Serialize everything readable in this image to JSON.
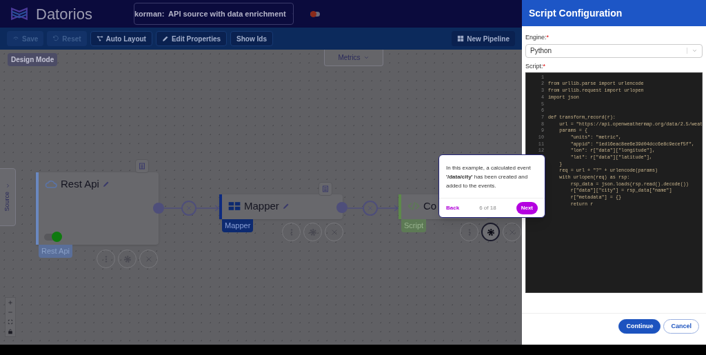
{
  "header": {
    "logo_text": "Datorios",
    "pipeline_selector": "korman:  API source with data enrichment",
    "toggle_on": false
  },
  "toolbar": {
    "buttons": [
      {
        "kind": "save",
        "label": "Save",
        "disabled": true
      },
      {
        "kind": "reset",
        "label": "Reset",
        "disabled": true
      },
      {
        "kind": "layout",
        "label": "Auto Layout",
        "disabled": false
      },
      {
        "kind": "edit",
        "label": "Edit Properties",
        "disabled": false
      },
      {
        "kind": "plain",
        "label": "Show Ids",
        "disabled": false
      }
    ],
    "new_pipeline": "New Pipeline"
  },
  "canvas": {
    "mode_badge": "Design Mode",
    "metrics_dropdown": "Metrics",
    "side_tab": "Source",
    "nodes": [
      {
        "kind": "api",
        "title": "Rest Api",
        "tag": "Rest Api",
        "enabled": true,
        "settings_selected": false
      },
      {
        "kind": "mapper",
        "title": "Mapper",
        "tag": "Mapper",
        "settings_selected": false
      },
      {
        "kind": "code",
        "title": "Co",
        "tag": "Script",
        "settings_selected": true
      }
    ]
  },
  "tour_popup": {
    "text": "In this example, a calculated event **'/data/city'** has been created and added to the events.",
    "back": "Back",
    "progress": "6 of 18",
    "next": "Next"
  },
  "panel": {
    "title": "Script Configuration",
    "engine_label": "Engine:",
    "engine_required": "*",
    "engine_value": "Python",
    "script_label": "Script:",
    "script_required": "*",
    "code_lines": [
      {
        "number": "1"
      },
      {
        "number": "2",
        "code": "from urllib.parse import urlencode"
      },
      {
        "number": "3",
        "code": "from urllib.request import urlopen"
      },
      {
        "number": "4",
        "code": "import json"
      },
      {
        "number": "5"
      },
      {
        "number": "6"
      },
      {
        "number": "7",
        "code": "def transform_record(r):"
      },
      {
        "number": "8",
        "code": "    url = \"https://api.openweathermap.org/data/2.5/weat"
      },
      {
        "number": "9",
        "code": "    params = {"
      },
      {
        "number": "10",
        "code": "        \"units\": \"metric\","
      },
      {
        "number": "11",
        "code": "        \"appid\": \"1ed16eac8ee6e39d04dcc6e8c9ecef5f\","
      },
      {
        "number": "12",
        "code": "        \"lon\": r[\"data\"][\"longitude\"],"
      },
      {
        "code": "        \"lat\": r[\"data\"][\"latitude\"],"
      },
      {
        "code": "    }"
      },
      {
        "code": "    req = url + \"?\" + urlencode(params)"
      },
      {
        "code": "    with urlopen(req) as rsp:"
      },
      {
        "code": "        rsp_data = json.loads(rsp.read().decode())"
      },
      {
        "code": "        r[\"data\"][\"city\"] = rsp_data[\"name\"]"
      },
      {
        "code": "        r[\"metadata\"] = {}"
      },
      {
        "code": "        return r"
      }
    ],
    "buttons": [
      {
        "kind": "primary",
        "label": "Continue"
      },
      {
        "kind": "secondary",
        "label": "Cancel"
      }
    ]
  }
}
